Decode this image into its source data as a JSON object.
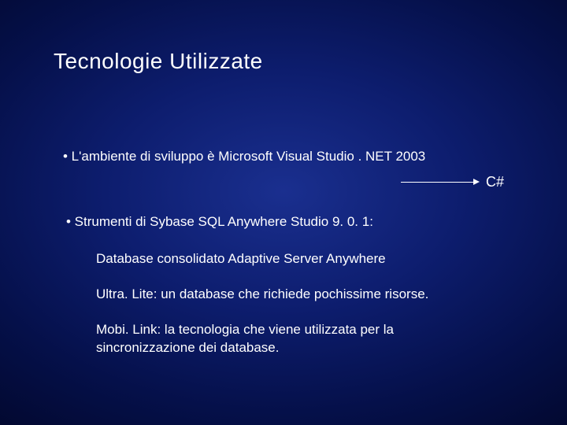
{
  "title": "Tecnologie Utilizzate",
  "bullet1": "• L'ambiente di sviluppo è Microsoft Visual Studio . NET 2003",
  "csharp": "C#",
  "bullet2": "• Strumenti di Sybase SQL Anywhere Studio 9. 0. 1:",
  "sub1": "Database consolidato Adaptive Server Anywhere",
  "sub2": "Ultra. Lite: un database che richiede pochissime risorse.",
  "sub3": "Mobi. Link: la tecnologia che viene utilizzata per la sincronizzazione dei database."
}
